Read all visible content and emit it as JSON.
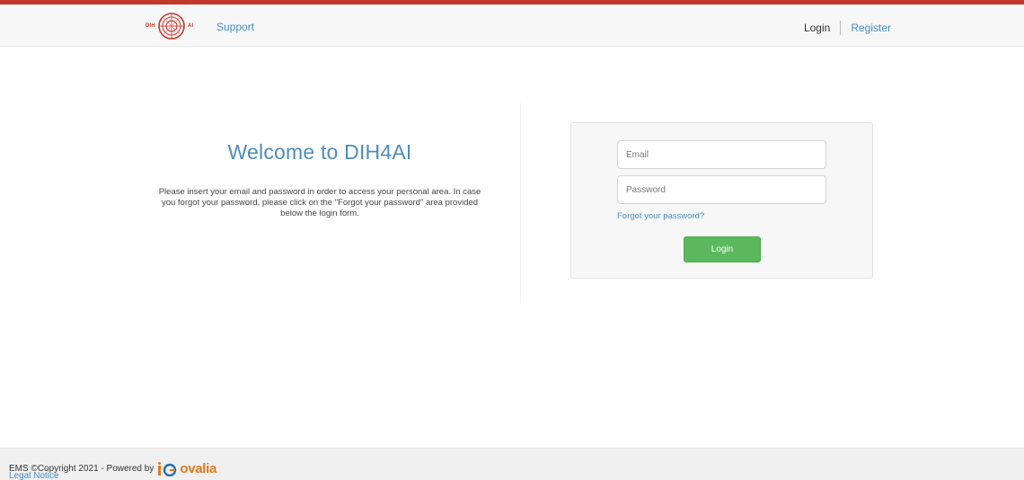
{
  "header": {
    "logo_left_text": "DIH",
    "logo_right_text": "AI",
    "support_label": "Support",
    "login_label": "Login",
    "register_label": "Register",
    "accent_color": "#c0392b",
    "link_color": "#4a8bbf"
  },
  "welcome": {
    "title": "Welcome to DIH4AI",
    "text": "Please insert your email and password in order to access your personal area. In case you forgot your password, please click on the \"Forgot your password\" area provided below the login form."
  },
  "login_form": {
    "email_placeholder": "Email",
    "password_placeholder": "Password",
    "forgot_label": "Forgot your password?",
    "submit_label": "Login",
    "submit_color": "#5cb85c"
  },
  "footer": {
    "copyright": "EMS ©Copyright 2021 - Powered by",
    "brand_name": "ovalia",
    "legal_label": "Legal Notice"
  }
}
